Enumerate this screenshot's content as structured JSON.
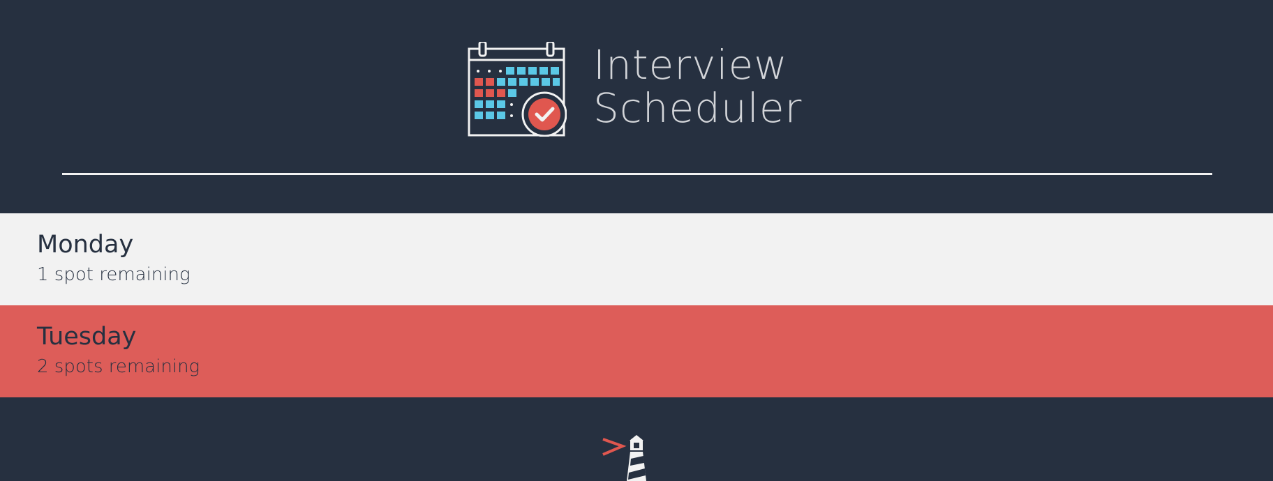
{
  "header": {
    "title_line1": "Interview",
    "title_line2": "Scheduler",
    "logo_icon": "calendar-check-icon"
  },
  "days": [
    {
      "name": "Monday",
      "spots": "1 spot remaining",
      "selected": false
    },
    {
      "name": "Tuesday",
      "spots": "2 spots remaining",
      "selected": true
    }
  ],
  "footer": {
    "logo_icon": "lighthouse-icon"
  },
  "colors": {
    "background": "#263040",
    "day_default": "#f2f2f2",
    "day_selected": "#dd5d59",
    "text_dark": "#263040",
    "accent_red": "#e0574f",
    "accent_blue": "#5bc8e6"
  }
}
